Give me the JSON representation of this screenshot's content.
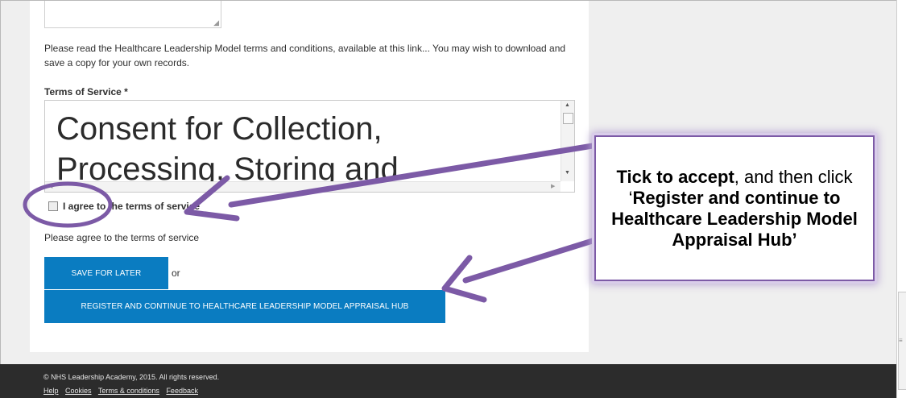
{
  "form": {
    "intro_text": "Please read the Healthcare Leadership Model terms and conditions, available at this link... You may wish to download and save a copy for your own records.",
    "tos_label": "Terms of Service *",
    "tos_visible_text": "Consent for Collection, Processing, Storing and",
    "agree_label": "I agree to the terms of service",
    "error_message": "Please agree to the terms of service",
    "save_button": "SAVE FOR LATER",
    "or_text": "or",
    "register_button": "REGISTER AND CONTINUE TO HEALTHCARE LEADERSHIP MODEL APPRAISAL HUB"
  },
  "footer": {
    "copyright": "© NHS Leadership Academy, 2015. All rights reserved.",
    "links": [
      "Help",
      "Cookies",
      "Terms & conditions",
      "Feedback"
    ]
  },
  "callout": {
    "part1": "Tick to accept",
    "part2": ", and then click ‘",
    "part3": "Register and continue to Healthcare Leadership Model Appraisal Hub’"
  },
  "colors": {
    "button_blue": "#0a7cc1",
    "annotation_purple": "#7c5aa6",
    "footer_bg": "#2c2c2c"
  },
  "icons": {
    "resize_grip": "resize-grip-icon",
    "scroll_arrows": "scroll-arrow-icon",
    "annotation_arrows": "arrow-icon"
  }
}
